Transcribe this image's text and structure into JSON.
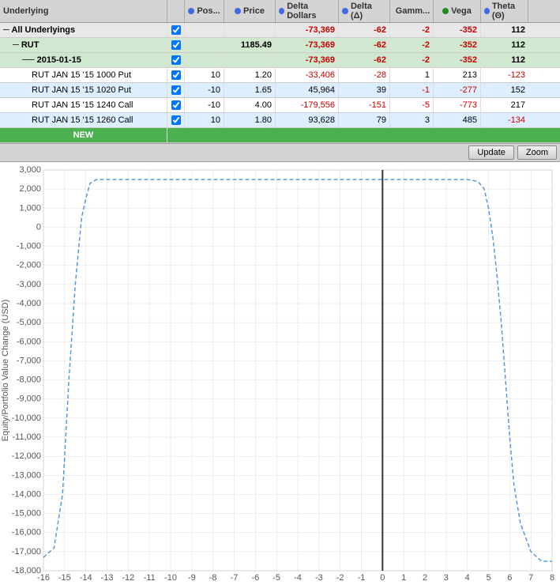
{
  "header": {
    "underlying_label": "Underlying",
    "pos_label": "Pos...",
    "price_label": "Price",
    "delta_dollars_label": "Delta Dollars",
    "delta_label": "Delta (Δ)",
    "gamma_label": "Gamm...",
    "vega_label": "Vega",
    "theta_label": "Theta (Θ)"
  },
  "rows": [
    {
      "type": "all",
      "name": "All Underlyings",
      "indent": 0,
      "checked": true,
      "pos": "",
      "price": "",
      "delta_dollars": "-73,369",
      "delta": "-62",
      "gamma": "-2",
      "vega": "-352",
      "theta": "112"
    },
    {
      "type": "rut",
      "name": "RUT",
      "indent": 1,
      "checked": true,
      "pos": "",
      "price": "1185.49",
      "delta_dollars": "-73,369",
      "delta": "-62",
      "gamma": "-2",
      "vega": "-352",
      "theta": "112"
    },
    {
      "type": "date",
      "name": "2015-01-15",
      "indent": 2,
      "checked": true,
      "pos": "",
      "price": "",
      "delta_dollars": "-73,369",
      "delta": "-62",
      "gamma": "-2",
      "vega": "-352",
      "theta": "112"
    },
    {
      "type": "pos1000",
      "name": "RUT JAN 15 '15 1000 Put",
      "indent": 3,
      "checked": true,
      "pos": "10",
      "price": "1.20",
      "delta_dollars": "-33,406",
      "delta": "-28",
      "gamma": "1",
      "vega": "213",
      "theta": "-123"
    },
    {
      "type": "pos1020",
      "name": "RUT JAN 15 '15 1020 Put",
      "indent": 3,
      "checked": true,
      "pos": "-10",
      "price": "1.65",
      "delta_dollars": "45,964",
      "delta": "39",
      "gamma": "-1",
      "vega": "-277",
      "theta": "152"
    },
    {
      "type": "pos1240",
      "name": "RUT JAN 15 '15 1240 Call",
      "indent": 3,
      "checked": true,
      "pos": "-10",
      "price": "4.00",
      "delta_dollars": "-179,556",
      "delta": "-151",
      "gamma": "-5",
      "vega": "-773",
      "theta": "217"
    },
    {
      "type": "pos1260",
      "name": "RUT JAN 15 '15 1260 Call",
      "indent": 3,
      "checked": true,
      "pos": "10",
      "price": "1.80",
      "delta_dollars": "93,628",
      "delta": "79",
      "gamma": "3",
      "vega": "485",
      "theta": "-134"
    },
    {
      "type": "new",
      "name": "NEW",
      "indent": 0
    }
  ],
  "toolbar": {
    "update_label": "Update",
    "zoom_label": "Zoom"
  },
  "chart": {
    "y_axis_label": "Equity/Portfolio Value Change (USD)",
    "x_min": -16,
    "x_max": 8,
    "y_min": -18000,
    "y_max": 3000,
    "y_ticks": [
      3000,
      2000,
      1000,
      0,
      -1000,
      -2000,
      -3000,
      -4000,
      -5000,
      -6000,
      -7000,
      -8000,
      -9000,
      -10000,
      -11000,
      -12000,
      -13000,
      -14000,
      -15000,
      -16000,
      -17000,
      -18000
    ],
    "x_ticks": [
      -16,
      -15,
      -14,
      -13,
      -12,
      -11,
      -10,
      -9,
      -8,
      -7,
      -6,
      -5,
      -4,
      -3,
      -2,
      -1,
      0,
      1,
      2,
      3,
      4,
      5,
      6,
      7,
      8
    ]
  }
}
